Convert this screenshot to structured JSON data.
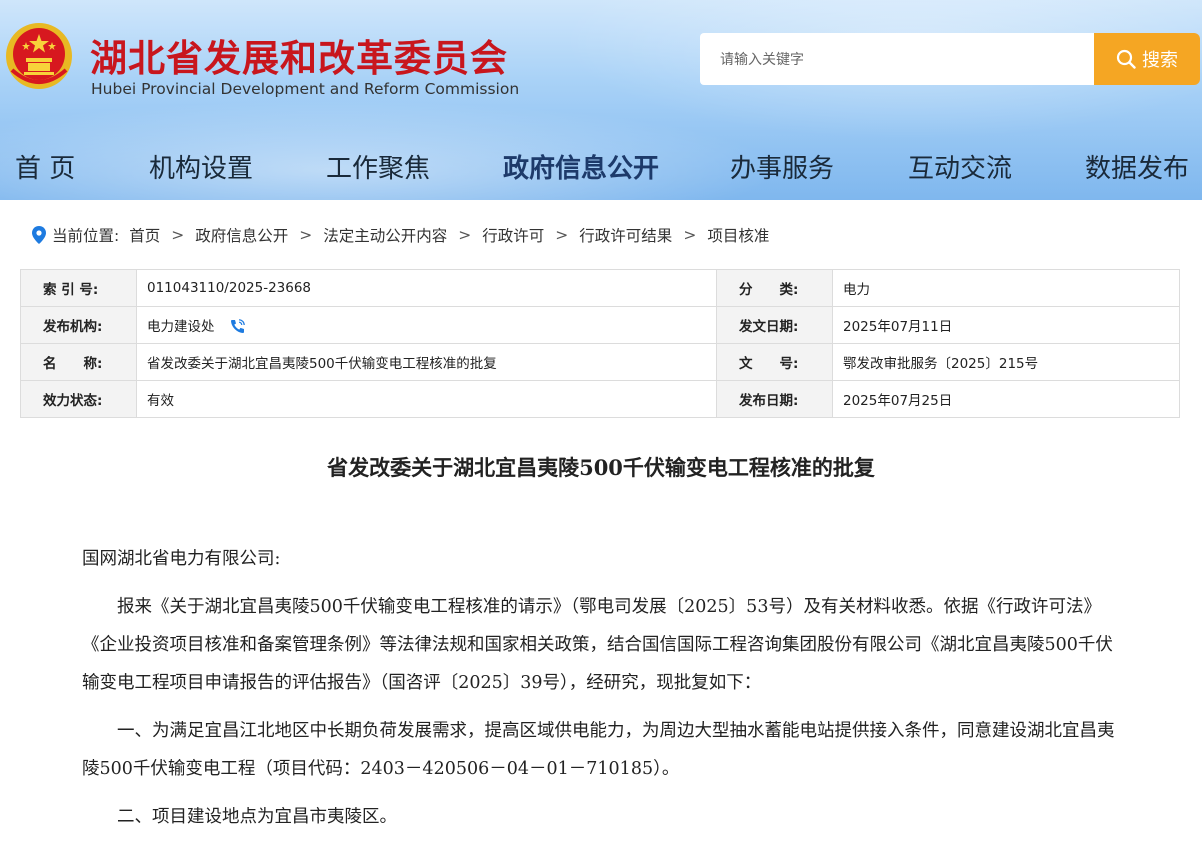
{
  "header": {
    "title": "湖北省发展和改革委员会",
    "subtitle": "Hubei Provincial Development and Reform Commission",
    "search_placeholder": "请输入关键字",
    "search_label": "搜索"
  },
  "nav": [
    "首 页",
    "机构设置",
    "工作聚焦",
    "政府信息公开",
    "办事服务",
    "互动交流",
    "数据发布"
  ],
  "breadcrumb": {
    "prefix": "当前位置:",
    "items": [
      "首页",
      "政府信息公开",
      "法定主动公开内容",
      "行政许可",
      "行政许可结果",
      "项目核准"
    ],
    "separator": ">"
  },
  "info": {
    "row1": {
      "l1": "索 引 号:",
      "v1": "011043110/2025-23668",
      "l2": "分　　类:",
      "v2": "电力"
    },
    "row2": {
      "l1": "发布机构:",
      "v1": "电力建设处",
      "l2": "发文日期:",
      "v2": "2025年07月11日"
    },
    "row3": {
      "l1": "名　　称:",
      "v1": "省发改委关于湖北宜昌夷陵500千伏输变电工程核准的批复",
      "l2": "文　　号:",
      "v2": "鄂发改审批服务〔2025〕215号"
    },
    "row4": {
      "l1": "效力状态:",
      "v1": "有效",
      "l2": "发布日期:",
      "v2": "2025年07月25日"
    }
  },
  "article": {
    "title": "省发改委关于湖北宜昌夷陵500千伏输变电工程核准的批复",
    "salutation": "国网湖北省电力有限公司:",
    "p1": "报来《关于湖北宜昌夷陵500千伏输变电工程核准的请示》（鄂电司发展〔2025〕53号）及有关材料收悉。依据《行政许可法》《企业投资项目核准和备案管理条例》等法律法规和国家相关政策，结合国信国际工程咨询集团股份有限公司《湖北宜昌夷陵500千伏输变电工程项目申请报告的评估报告》（国咨评〔2025〕39号），经研究，现批复如下：",
    "p2": "一、为满足宜昌江北地区中长期负荷发展需求，提高区域供电能力，为周边大型抽水蓄能电站提供接入条件，同意建设湖北宜昌夷陵500千伏输变电工程（项目代码：2403－420506－04－01－710185）。",
    "p3": "二、项目建设地点为宜昌市夷陵区。"
  },
  "colors": {
    "title_red": "#c8161d",
    "search_orange": "#f5a623",
    "pin_blue": "#1e7be0"
  }
}
